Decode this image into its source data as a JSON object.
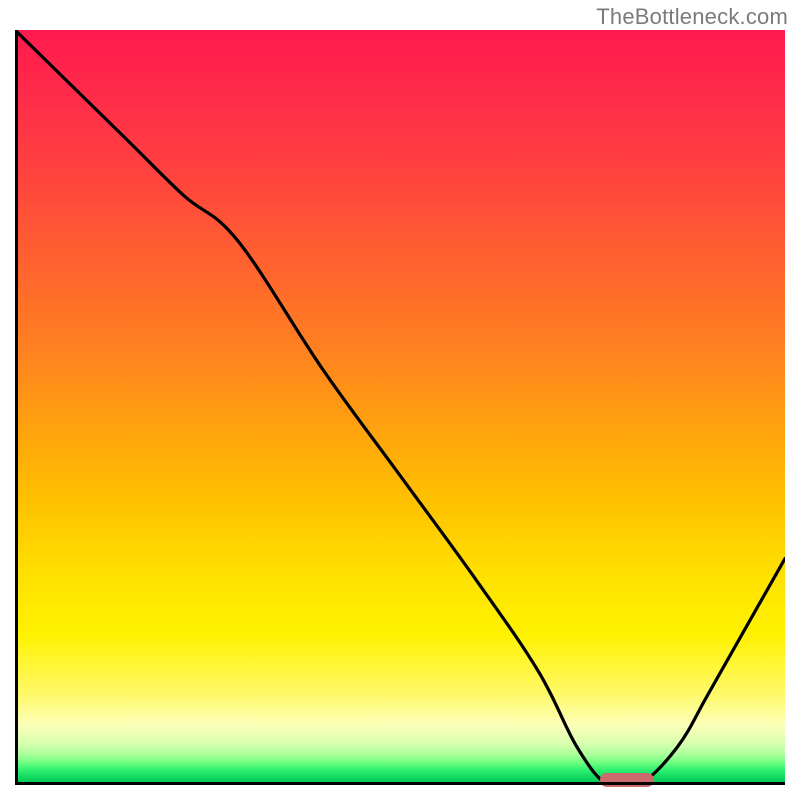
{
  "watermark": "TheBottleneck.com",
  "colors": {
    "top": "#ff1a4d",
    "mid": "#ffe000",
    "bottom": "#00c050",
    "curve": "#000000",
    "marker": "#cd6a6e"
  },
  "chart_data": {
    "type": "line",
    "title": "",
    "xlabel": "",
    "ylabel": "",
    "xlim": [
      0,
      100
    ],
    "ylim": [
      0,
      100
    ],
    "x": [
      0,
      8,
      15,
      22,
      29,
      40,
      50,
      60,
      68,
      73,
      77,
      81,
      86,
      90,
      95,
      100
    ],
    "values": [
      100,
      92,
      85,
      78,
      72,
      55,
      41,
      27,
      15,
      5,
      0,
      0,
      5,
      12,
      21,
      30
    ],
    "marker": {
      "x_start": 76,
      "x_end": 83,
      "y": 0
    },
    "annotations": []
  }
}
